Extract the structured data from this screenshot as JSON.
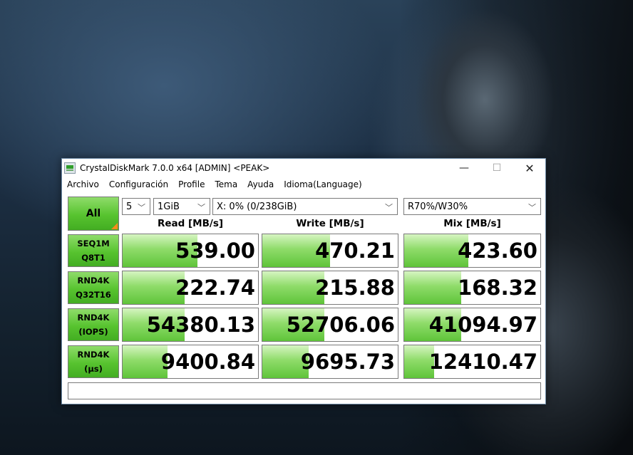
{
  "window": {
    "title": "CrystalDiskMark 7.0.0 x64 [ADMIN] <PEAK>",
    "minimize_glyph": "—",
    "maximize_glyph": "☐",
    "close_glyph": "✕"
  },
  "menu": [
    "Archivo",
    "Configuración",
    "Profile",
    "Tema",
    "Ayuda",
    "Idioma(Language)"
  ],
  "controls": {
    "all_label": "All",
    "count": "5",
    "size": "1GiB",
    "drive": "X: 0% (0/238GiB)",
    "mix_ratio": "R70%/W30%",
    "chevron": "﹀"
  },
  "headers": {
    "read": "Read [MB/s]",
    "write": "Write [MB/s]",
    "mix": "Mix [MB/s]"
  },
  "rows": [
    {
      "line1": "SEQ1M",
      "line2": "Q8T1",
      "read": "539.00",
      "write": "470.21",
      "mix": "423.60",
      "read_fill": 0.55,
      "write_fill": 0.5,
      "mix_fill": 0.47
    },
    {
      "line1": "RND4K",
      "line2": "Q32T16",
      "read": "222.74",
      "write": "215.88",
      "mix": "168.32",
      "read_fill": 0.46,
      "write_fill": 0.46,
      "mix_fill": 0.42
    },
    {
      "line1": "RND4K",
      "line2": "(IOPS)",
      "read": "54380.13",
      "write": "52706.06",
      "mix": "41094.97",
      "read_fill": 0.46,
      "write_fill": 0.46,
      "mix_fill": 0.42
    },
    {
      "line1": "RND4K",
      "line2": "(µs)",
      "read": "9400.84",
      "write": "9695.73",
      "mix": "12410.47",
      "read_fill": 0.33,
      "write_fill": 0.34,
      "mix_fill": 0.22
    }
  ],
  "comment": ""
}
